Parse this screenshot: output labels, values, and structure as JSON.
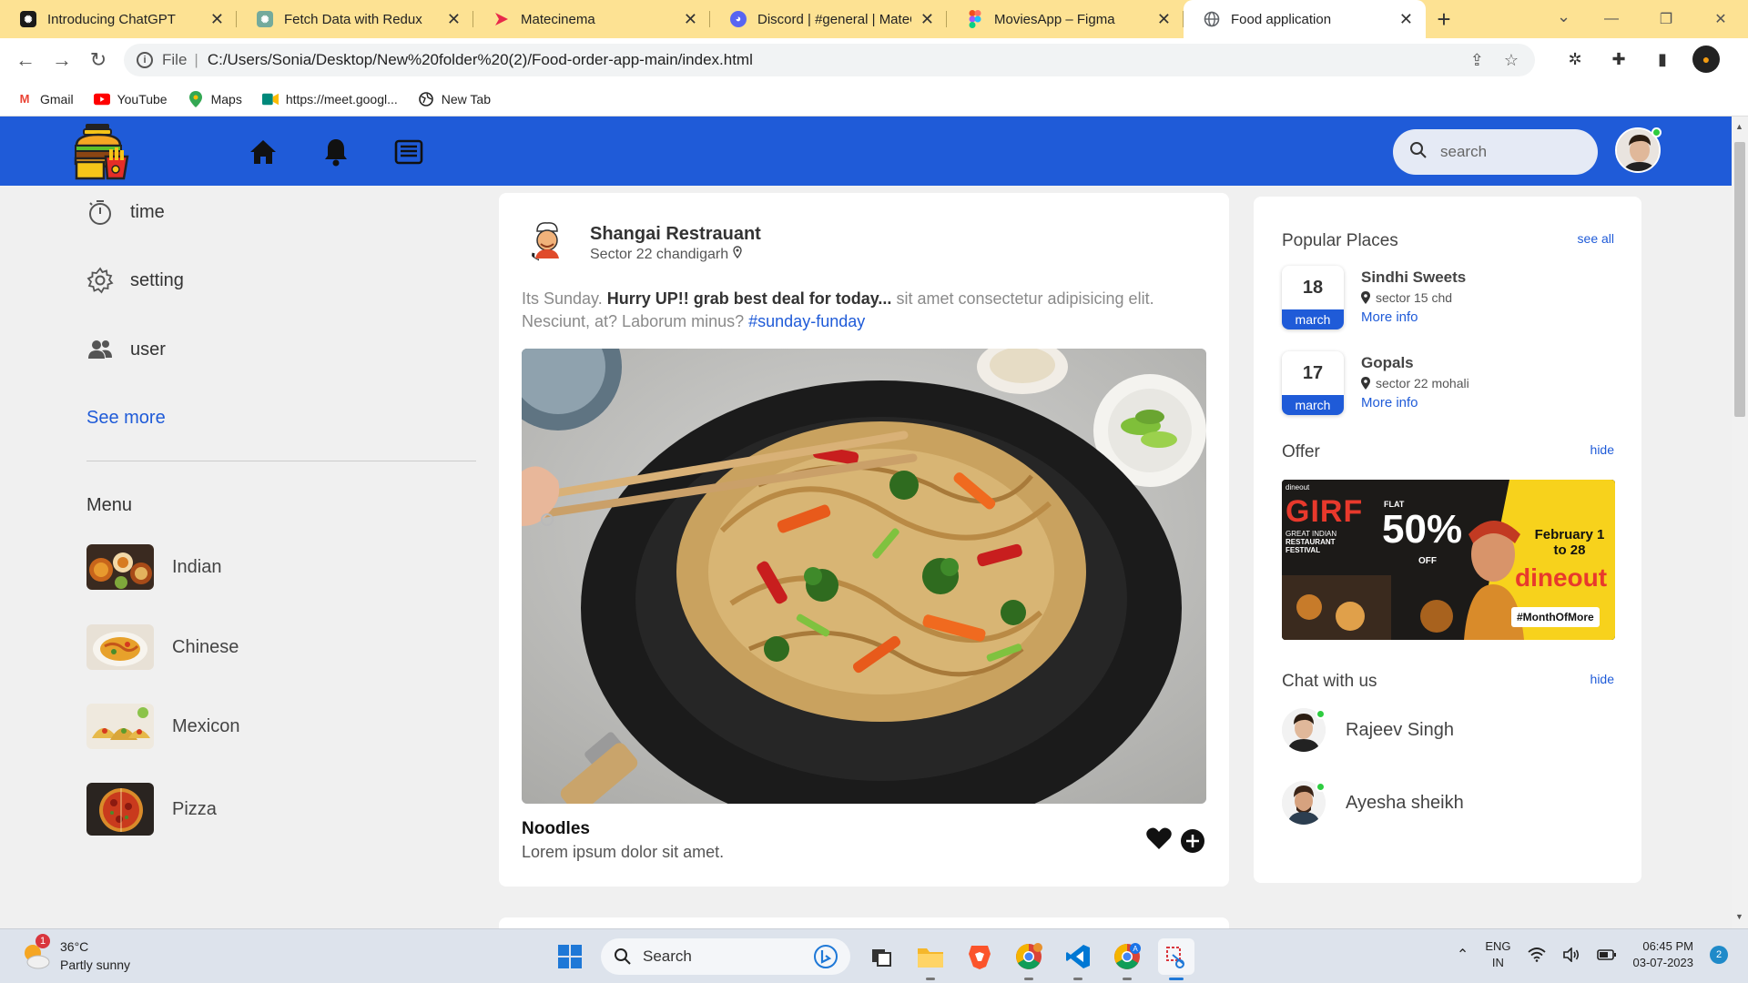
{
  "browser": {
    "tabs": [
      {
        "title": "Introducing ChatGPT",
        "icon": "chatgpt-icon",
        "color": "#1a1a1a",
        "active": false
      },
      {
        "title": "Fetch Data with Redux",
        "icon": "chatgpt-icon",
        "color": "#74aa9c",
        "active": false
      },
      {
        "title": "Matecinema",
        "icon": "matecinema-icon",
        "color": "#e8294a",
        "active": false
      },
      {
        "title": "Discord | #general | MateCi",
        "icon": "discord-icon",
        "color": "#5865f2",
        "active": false
      },
      {
        "title": "MoviesApp – Figma",
        "icon": "figma-icon",
        "color": "#f24e1e",
        "active": false
      },
      {
        "title": "Food application",
        "icon": "globe-icon",
        "color": "#5f6368",
        "active": true
      }
    ],
    "address": {
      "scheme_label": "File",
      "url": "C:/Users/Sonia/Desktop/New%20folder%20(2)/Food-order-app-main/index.html"
    },
    "bookmarks": [
      {
        "label": "Gmail",
        "icon": "gmail-icon",
        "color": "#ea4335"
      },
      {
        "label": "YouTube",
        "icon": "youtube-icon",
        "color": "#ff0000"
      },
      {
        "label": "Maps",
        "icon": "maps-icon",
        "color": "#34a853"
      },
      {
        "label": "https://meet.googl...",
        "icon": "meet-icon",
        "color": "#00897b"
      },
      {
        "label": "New Tab",
        "icon": "globe-icon",
        "color": "#222222"
      }
    ]
  },
  "header": {
    "brand_color": "#1f5bd8",
    "search_placeholder": "search"
  },
  "sidebar": {
    "items": [
      {
        "label": "time",
        "icon": "stopwatch-icon"
      },
      {
        "label": "setting",
        "icon": "gear-icon"
      },
      {
        "label": "user",
        "icon": "users-icon"
      }
    ],
    "see_more": "See more",
    "menu_title": "Menu",
    "menu": [
      {
        "label": "Indian"
      },
      {
        "label": "Chinese"
      },
      {
        "label": "Mexicon"
      },
      {
        "label": "Pizza"
      }
    ]
  },
  "post": {
    "restaurant_name": "Shangai Restrauant",
    "location": "Sector 22 chandigarh",
    "text_plain_1": "Its Sunday. ",
    "text_bold": "Hurry UP!! grab best deal for today...",
    "text_plain_2": " sit amet consectetur adipisicing elit. Nesciunt, at? Laborum minus? ",
    "hashtag": "#sunday-funday",
    "dish_name": "Noodles",
    "dish_description": "Lorem ipsum dolor sit amet."
  },
  "right_panel": {
    "popular_title": "Popular Places",
    "see_all": "see all",
    "places": [
      {
        "day": "18",
        "month": "march",
        "name": "Sindhi Sweets",
        "location": "sector 15 chd",
        "more": "More info"
      },
      {
        "day": "17",
        "month": "march",
        "name": "Gopals",
        "location": "sector 22 mohali",
        "more": "More info"
      }
    ],
    "offer_title": "Offer",
    "offer_hide": "hide",
    "banner": {
      "brand_small": "dineout",
      "girf": "GIRF",
      "festival_line1": "GREAT INDIAN",
      "festival_line2": "RESTAURANT",
      "festival_line3": "FESTIVAL",
      "flat": "FLAT",
      "percent": "50%",
      "off": "OFF",
      "dates": "February 1 to 28",
      "dineout": "dineout",
      "hashtag": "#MonthOfMore"
    },
    "chat_title": "Chat with us",
    "chat_hide": "hide",
    "contacts": [
      {
        "name": "Rajeev Singh",
        "online": true
      },
      {
        "name": "Ayesha sheikh",
        "online": true
      }
    ]
  },
  "taskbar": {
    "weather_temp": "36°C",
    "weather_desc": "Partly sunny",
    "weather_badge": "1",
    "search_label": "Search",
    "lang_line1": "ENG",
    "lang_line2": "IN",
    "time": "06:45 PM",
    "date": "03-07-2023",
    "notifications": "2"
  }
}
